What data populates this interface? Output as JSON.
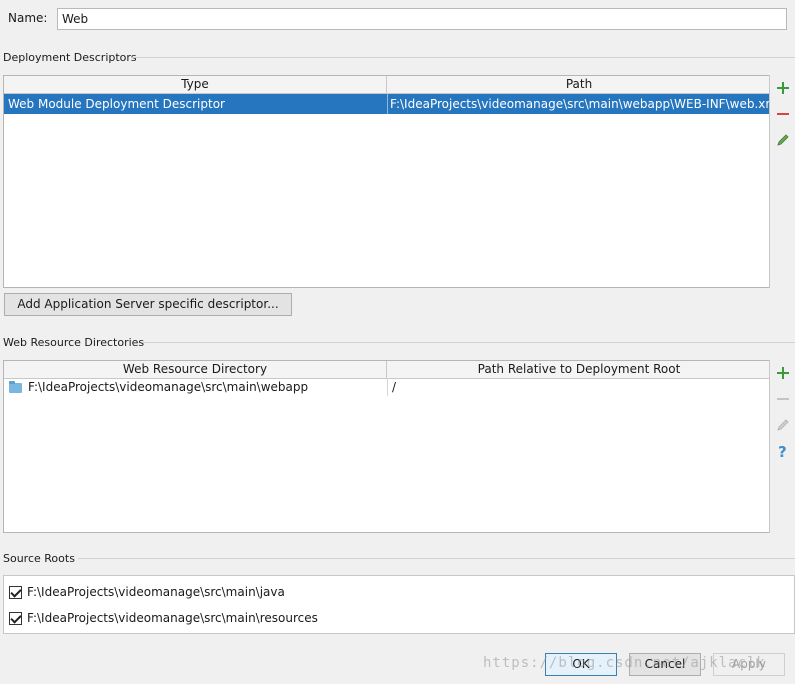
{
  "name": {
    "label": "Name:",
    "value": "Web"
  },
  "deployment_descriptors": {
    "title": "Deployment Descriptors",
    "columns": [
      "Type",
      "Path"
    ],
    "rows": [
      {
        "type": "Web Module Deployment Descriptor",
        "path": "F:\\IdeaProjects\\videomanage\\src\\main\\webapp\\WEB-INF\\web.xml"
      }
    ],
    "add_button": "Add Application Server specific descriptor..."
  },
  "web_resource_directories": {
    "title": "Web Resource Directories",
    "columns": [
      "Web Resource Directory",
      "Path Relative to Deployment Root"
    ],
    "rows": [
      {
        "directory": "F:\\IdeaProjects\\videomanage\\src\\main\\webapp",
        "relative": "/"
      }
    ]
  },
  "source_roots": {
    "title": "Source Roots",
    "items": [
      {
        "path": "F:\\IdeaProjects\\videomanage\\src\\main\\java",
        "checked": true
      },
      {
        "path": "F:\\IdeaProjects\\videomanage\\src\\main\\resources",
        "checked": true
      }
    ]
  },
  "footer": {
    "ok": "OK",
    "cancel": "Cancel",
    "apply": "Apply"
  },
  "watermark": "https://blog.csdn.net/ajklaclk",
  "icons": {
    "add": "plus-icon",
    "remove": "minus-icon",
    "edit": "pencil-icon",
    "help": "question-icon"
  },
  "colors": {
    "selection": "#2675bf",
    "add": "#3a9a3a",
    "remove": "#d9443f",
    "help": "#3f8fd0"
  }
}
